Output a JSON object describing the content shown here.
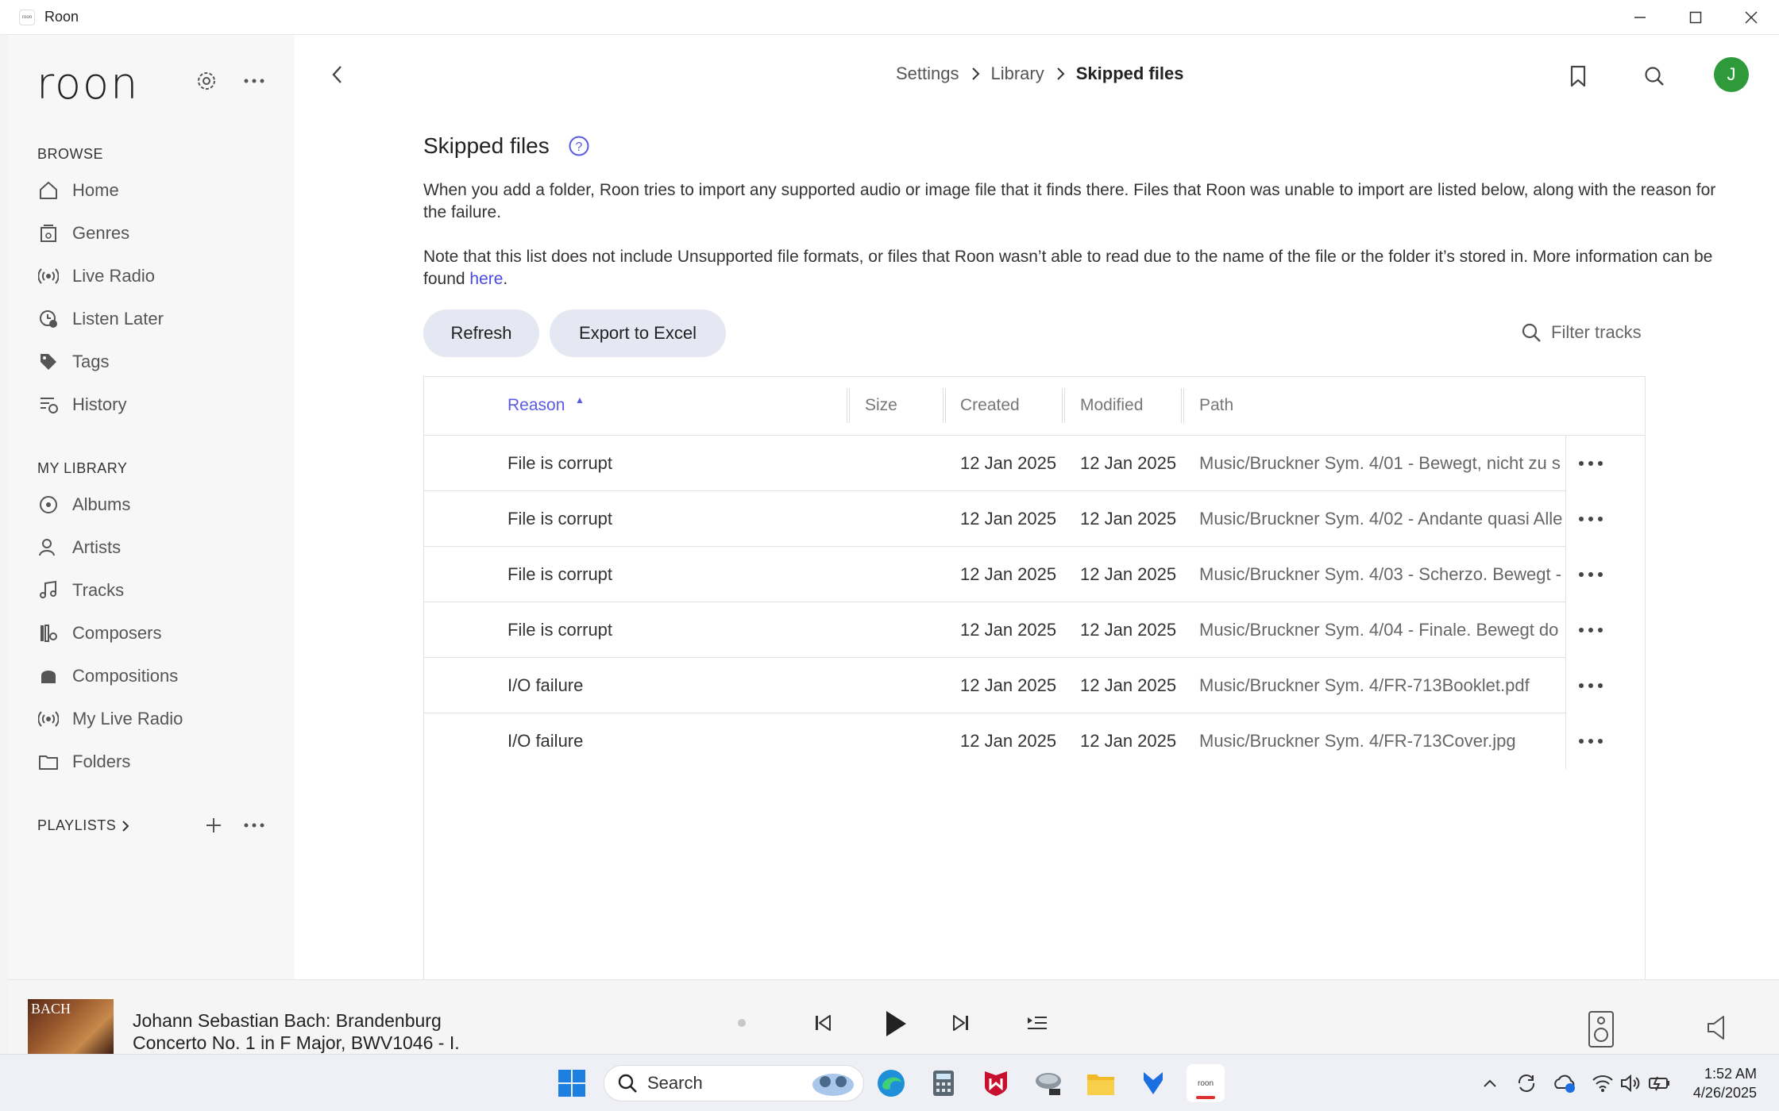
{
  "window": {
    "title": "Roon",
    "app_icon_text": "roon"
  },
  "sidebar": {
    "logo": "roon",
    "browse_header": "BROWSE",
    "browse_items": [
      {
        "label": "Home",
        "icon": "home-icon"
      },
      {
        "label": "Genres",
        "icon": "genres-icon"
      },
      {
        "label": "Live Radio",
        "icon": "radio-icon"
      },
      {
        "label": "Listen Later",
        "icon": "listen-later-icon"
      },
      {
        "label": "Tags",
        "icon": "tag-icon"
      },
      {
        "label": "History",
        "icon": "history-icon"
      }
    ],
    "library_header": "MY LIBRARY",
    "library_items": [
      {
        "label": "Albums",
        "icon": "albums-icon"
      },
      {
        "label": "Artists",
        "icon": "artists-icon"
      },
      {
        "label": "Tracks",
        "icon": "tracks-icon"
      },
      {
        "label": "Composers",
        "icon": "composers-icon"
      },
      {
        "label": "Compositions",
        "icon": "compositions-icon"
      },
      {
        "label": "My Live Radio",
        "icon": "radio-icon"
      },
      {
        "label": "Folders",
        "icon": "folder-icon"
      }
    ],
    "playlists_header": "PLAYLISTS"
  },
  "header": {
    "breadcrumb": [
      "Settings",
      "Library",
      "Skipped files"
    ],
    "avatar_initial": "J",
    "avatar_color": "#2e9a3a"
  },
  "page": {
    "title": "Skipped files",
    "para1": "When you add a folder, Roon tries to import any supported audio or image file that it finds there. Files that Roon was unable to import are listed below, along with the reason for the failure.",
    "para2_text": "Note that this list does not include Unsupported file formats, or files that Roon wasn’t able to read due to the name of the file or the folder it’s stored in. More information can be found ",
    "para2_link": "here",
    "para2_end": ".",
    "refresh_label": "Refresh",
    "export_label": "Export to Excel",
    "filter_placeholder": "Filter tracks"
  },
  "table": {
    "columns": [
      "Reason",
      "Size",
      "Created",
      "Modified",
      "Path"
    ],
    "sort_column": "Reason",
    "sort_indicator": "▲",
    "rows": [
      {
        "reason": "File is corrupt",
        "size": "",
        "created": "12 Jan 2025",
        "modified": "12 Jan 2025",
        "path": "Music/Bruckner Sym. 4/01 - Bewegt, nicht zu s"
      },
      {
        "reason": "File is corrupt",
        "size": "",
        "created": "12 Jan 2025",
        "modified": "12 Jan 2025",
        "path": "Music/Bruckner Sym. 4/02 - Andante quasi Alle"
      },
      {
        "reason": "File is corrupt",
        "size": "",
        "created": "12 Jan 2025",
        "modified": "12 Jan 2025",
        "path": "Music/Bruckner Sym. 4/03 - Scherzo. Bewegt -"
      },
      {
        "reason": "File is corrupt",
        "size": "",
        "created": "12 Jan 2025",
        "modified": "12 Jan 2025",
        "path": "Music/Bruckner Sym. 4/04 - Finale. Bewegt do"
      },
      {
        "reason": "I/O failure",
        "size": "",
        "created": "12 Jan 2025",
        "modified": "12 Jan 2025",
        "path": "Music/Bruckner Sym. 4/FR-713Booklet.pdf"
      },
      {
        "reason": "I/O failure",
        "size": "",
        "created": "12 Jan 2025",
        "modified": "12 Jan 2025",
        "path": "Music/Bruckner Sym. 4/FR-713Cover.jpg"
      }
    ]
  },
  "player": {
    "album_art_text": "BACH",
    "track_line1": "Johann Sebastian Bach: Brandenburg",
    "track_line2": "Concerto No. 1 in F Major, BWV1046 - I."
  },
  "taskbar": {
    "search_label": "Search",
    "time": "1:52 AM",
    "date": "4/26/2025"
  },
  "colors": {
    "accent": "#5b5be8",
    "pill_bg": "#e5e8f3",
    "sidebar_bg": "#f7f7f7"
  }
}
